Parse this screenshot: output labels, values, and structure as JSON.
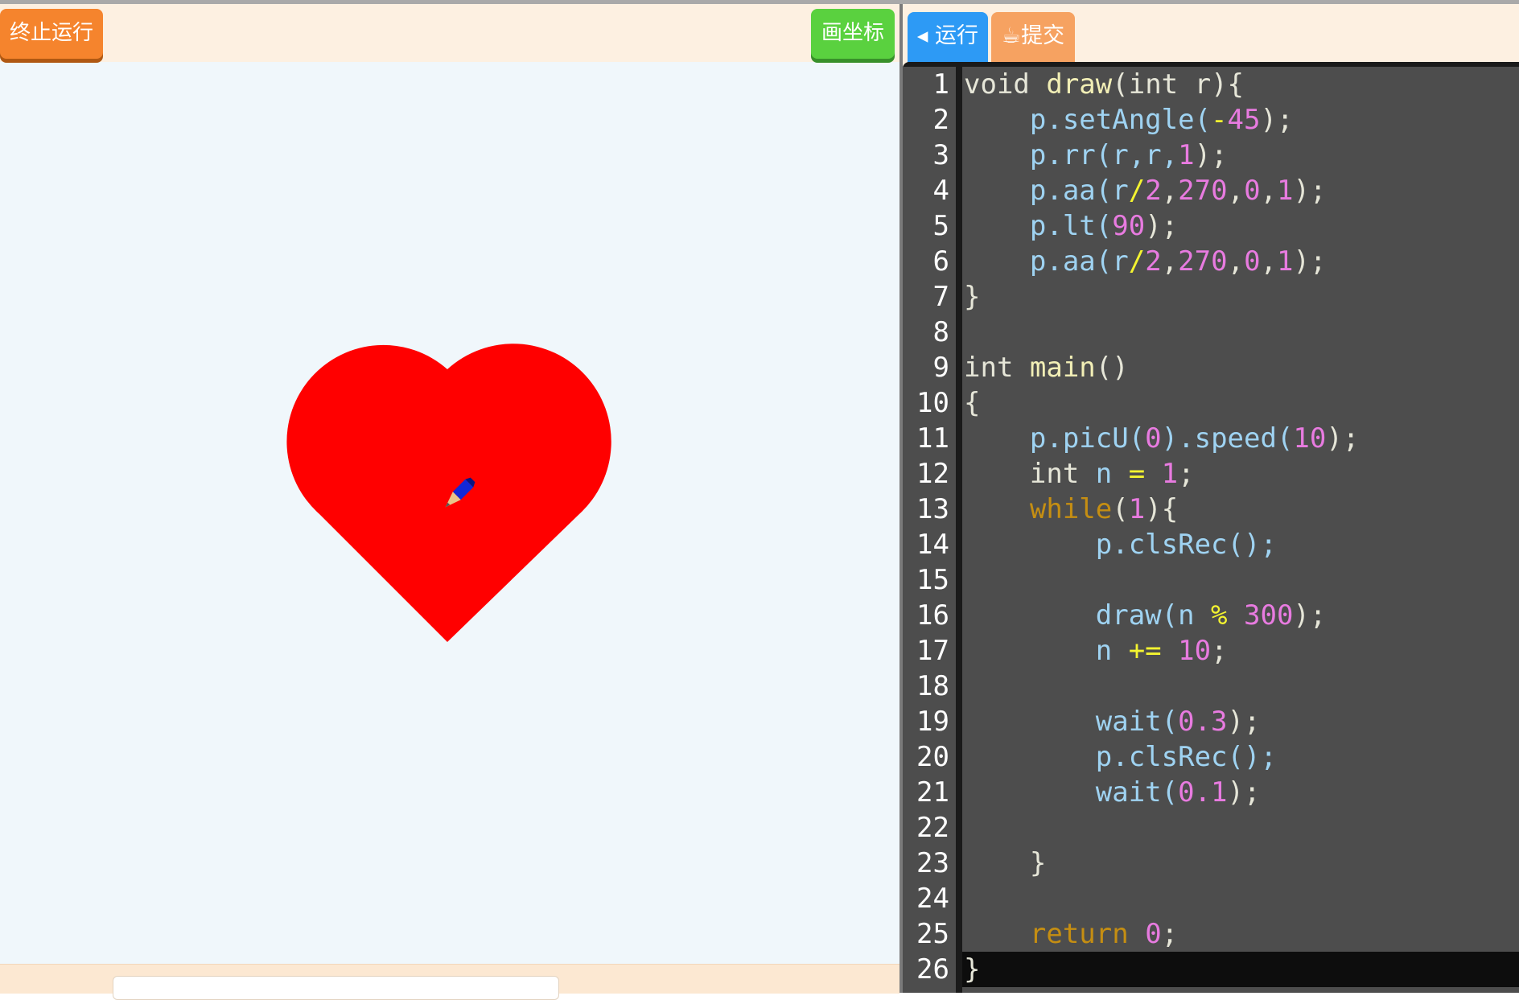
{
  "left_toolbar": {
    "stop_label": "终止运行",
    "axis_label": "画坐标"
  },
  "canvas": {
    "shape": "heart",
    "shape_color": "#ff0000",
    "cursor": "pencil-cursor-icon"
  },
  "left_bottom": {
    "label": "",
    "input_value": ""
  },
  "right_toolbar": {
    "run_label": "◂ 运行",
    "submit_label": "☕提交"
  },
  "editor": {
    "active_line": 26,
    "lines": [
      {
        "n": "1",
        "tokens": [
          {
            "t": "void ",
            "c": "plain"
          },
          {
            "t": "draw",
            "c": "fn"
          },
          {
            "t": "(int r){",
            "c": "plain"
          }
        ]
      },
      {
        "n": "2",
        "tokens": [
          {
            "t": "    p.setAngle(",
            "c": "ident"
          },
          {
            "t": "-",
            "c": "op"
          },
          {
            "t": "45",
            "c": "num"
          },
          {
            "t": ");",
            "c": "plain"
          }
        ]
      },
      {
        "n": "3",
        "tokens": [
          {
            "t": "    p.rr(r,r,",
            "c": "ident"
          },
          {
            "t": "1",
            "c": "num"
          },
          {
            "t": ");",
            "c": "plain"
          }
        ]
      },
      {
        "n": "4",
        "tokens": [
          {
            "t": "    p.aa(r",
            "c": "ident"
          },
          {
            "t": "/",
            "c": "op"
          },
          {
            "t": "2",
            "c": "num"
          },
          {
            "t": ",",
            "c": "plain"
          },
          {
            "t": "270",
            "c": "num"
          },
          {
            "t": ",",
            "c": "plain"
          },
          {
            "t": "0",
            "c": "num"
          },
          {
            "t": ",",
            "c": "plain"
          },
          {
            "t": "1",
            "c": "num"
          },
          {
            "t": ");",
            "c": "plain"
          }
        ]
      },
      {
        "n": "5",
        "tokens": [
          {
            "t": "    p.lt(",
            "c": "ident"
          },
          {
            "t": "90",
            "c": "num"
          },
          {
            "t": ");",
            "c": "plain"
          }
        ]
      },
      {
        "n": "6",
        "tokens": [
          {
            "t": "    p.aa(r",
            "c": "ident"
          },
          {
            "t": "/",
            "c": "op"
          },
          {
            "t": "2",
            "c": "num"
          },
          {
            "t": ",",
            "c": "plain"
          },
          {
            "t": "270",
            "c": "num"
          },
          {
            "t": ",",
            "c": "plain"
          },
          {
            "t": "0",
            "c": "num"
          },
          {
            "t": ",",
            "c": "plain"
          },
          {
            "t": "1",
            "c": "num"
          },
          {
            "t": ");",
            "c": "plain"
          }
        ]
      },
      {
        "n": "7",
        "tokens": [
          {
            "t": "}",
            "c": "plain"
          }
        ]
      },
      {
        "n": "8",
        "tokens": []
      },
      {
        "n": "9",
        "tokens": [
          {
            "t": "int ",
            "c": "plain"
          },
          {
            "t": "main",
            "c": "fn"
          },
          {
            "t": "()",
            "c": "plain"
          }
        ]
      },
      {
        "n": "10",
        "tokens": [
          {
            "t": "{",
            "c": "plain"
          }
        ]
      },
      {
        "n": "11",
        "tokens": [
          {
            "t": "    p.picU(",
            "c": "ident"
          },
          {
            "t": "0",
            "c": "num"
          },
          {
            "t": ").speed(",
            "c": "ident"
          },
          {
            "t": "10",
            "c": "num"
          },
          {
            "t": ");",
            "c": "plain"
          }
        ]
      },
      {
        "n": "12",
        "tokens": [
          {
            "t": "    int ",
            "c": "plain"
          },
          {
            "t": "n ",
            "c": "ident"
          },
          {
            "t": "= ",
            "c": "op"
          },
          {
            "t": "1",
            "c": "num"
          },
          {
            "t": ";",
            "c": "plain"
          }
        ]
      },
      {
        "n": "13",
        "tokens": [
          {
            "t": "    ",
            "c": "plain"
          },
          {
            "t": "while",
            "c": "kw"
          },
          {
            "t": "(",
            "c": "plain"
          },
          {
            "t": "1",
            "c": "num"
          },
          {
            "t": "){",
            "c": "plain"
          }
        ]
      },
      {
        "n": "14",
        "tokens": [
          {
            "t": "        p.clsRec();",
            "c": "ident"
          }
        ]
      },
      {
        "n": "15",
        "tokens": []
      },
      {
        "n": "16",
        "tokens": [
          {
            "t": "        draw(n ",
            "c": "ident"
          },
          {
            "t": "% ",
            "c": "op"
          },
          {
            "t": "300",
            "c": "num"
          },
          {
            "t": ");",
            "c": "plain"
          }
        ]
      },
      {
        "n": "17",
        "tokens": [
          {
            "t": "        n ",
            "c": "ident"
          },
          {
            "t": "+= ",
            "c": "op"
          },
          {
            "t": "10",
            "c": "num"
          },
          {
            "t": ";",
            "c": "plain"
          }
        ]
      },
      {
        "n": "18",
        "tokens": []
      },
      {
        "n": "19",
        "tokens": [
          {
            "t": "        wait(",
            "c": "ident"
          },
          {
            "t": "0.3",
            "c": "num"
          },
          {
            "t": ");",
            "c": "plain"
          }
        ]
      },
      {
        "n": "20",
        "tokens": [
          {
            "t": "        p.clsRec();",
            "c": "ident"
          }
        ]
      },
      {
        "n": "21",
        "tokens": [
          {
            "t": "        wait(",
            "c": "ident"
          },
          {
            "t": "0.1",
            "c": "num"
          },
          {
            "t": ");",
            "c": "plain"
          }
        ]
      },
      {
        "n": "22",
        "tokens": []
      },
      {
        "n": "23",
        "tokens": [
          {
            "t": "    }",
            "c": "plain"
          }
        ]
      },
      {
        "n": "24",
        "tokens": []
      },
      {
        "n": "25",
        "tokens": [
          {
            "t": "    ",
            "c": "plain"
          },
          {
            "t": "return ",
            "c": "kw"
          },
          {
            "t": "0",
            "c": "num"
          },
          {
            "t": ";",
            "c": "plain"
          }
        ]
      },
      {
        "n": "26",
        "tokens": [
          {
            "t": "}",
            "c": "plain"
          }
        ]
      }
    ]
  }
}
